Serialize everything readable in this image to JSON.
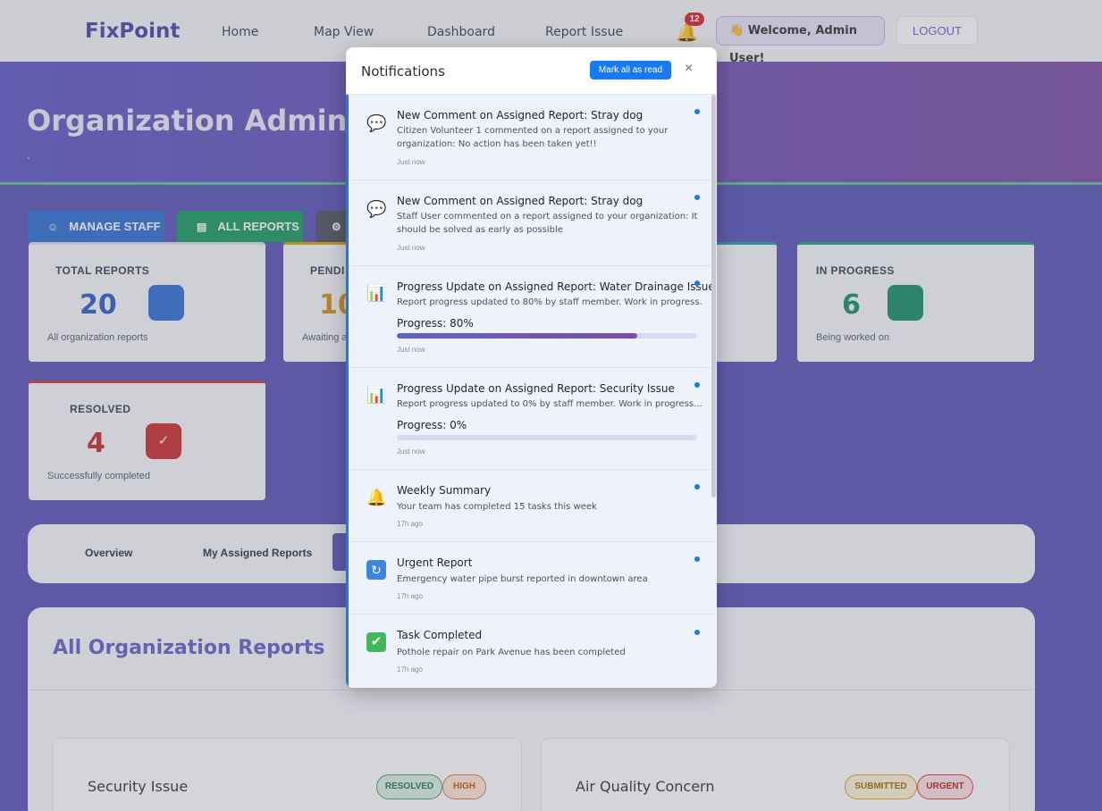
{
  "nav": {
    "brand": "FixPoint",
    "links": [
      "Home",
      "Map View",
      "Dashboard",
      "Report Issue"
    ],
    "notification_count": "12",
    "welcome": "Welcome, Admin User!",
    "logout": "LOGOUT"
  },
  "hero": {
    "title": "Organization Admin D",
    "subtitle": "."
  },
  "actions": {
    "manage_staff": "MANAGE STAFF",
    "all_reports": "ALL REPORTS"
  },
  "stats": [
    {
      "label": "TOTAL REPORTS",
      "value": "20",
      "desc": "All organization reports",
      "color": "#2b6fd6"
    },
    {
      "label": "PENDI",
      "value": "10",
      "desc": "Awaiting a",
      "color": "#e29a18"
    },
    {
      "label": "IN PROGRESS",
      "value": "6",
      "desc": "Being worked on",
      "color": "#139068"
    },
    {
      "label": "RESOLVED",
      "value": "4",
      "desc": "Successfully completed",
      "color": "#cc3030"
    }
  ],
  "tabs": [
    "Overview",
    "My Assigned Reports"
  ],
  "reports": {
    "title": "All Organization Reports",
    "cards": [
      {
        "name": "Security Issue",
        "status": "RESOLVED",
        "priority": "HIGH"
      },
      {
        "name": "Air Quality Concern",
        "status": "SUBMITTED",
        "priority": "URGENT"
      }
    ]
  },
  "modal": {
    "title": "Notifications",
    "mark_all": "Mark all as read",
    "close": "×",
    "items": [
      {
        "icon": "speech-bubble-icon",
        "title": "New Comment on Assigned Report: Stray dog",
        "message": "Citizen Volunteer 1 commented on a report assigned to your organization: No action has been taken yet!!",
        "time": "Just now"
      },
      {
        "icon": "speech-bubble-icon",
        "title": "New Comment on Assigned Report: Stray dog",
        "message": "Staff User commented on a report assigned to your organization: It should be solved as early as possible",
        "time": "Just now"
      },
      {
        "icon": "bar-chart-icon",
        "title": "Progress Update on Assigned Report: Water Drainage Issue",
        "message": "Report progress updated to 80% by staff member. Work in progress...",
        "progress_label": "Progress: 80%",
        "progress": 0.8,
        "time": "Just now"
      },
      {
        "icon": "bar-chart-icon",
        "title": "Progress Update on Assigned Report: Security Issue",
        "message": "Report progress updated to 0% by staff member. Work in progress...",
        "progress_label": "Progress: 0%",
        "progress": 0,
        "time": "Just now"
      },
      {
        "icon": "bell-icon",
        "title": "Weekly Summary",
        "message": "Your team has completed 15 tasks this week",
        "time": "17h ago"
      },
      {
        "icon": "refresh-icon",
        "title": "Urgent Report",
        "message": "Emergency water pipe burst reported in downtown area",
        "time": "17h ago"
      },
      {
        "icon": "check-icon",
        "title": "Task Completed",
        "message": "Pothole repair on Park Avenue has been completed",
        "time": "17h ago"
      }
    ]
  }
}
